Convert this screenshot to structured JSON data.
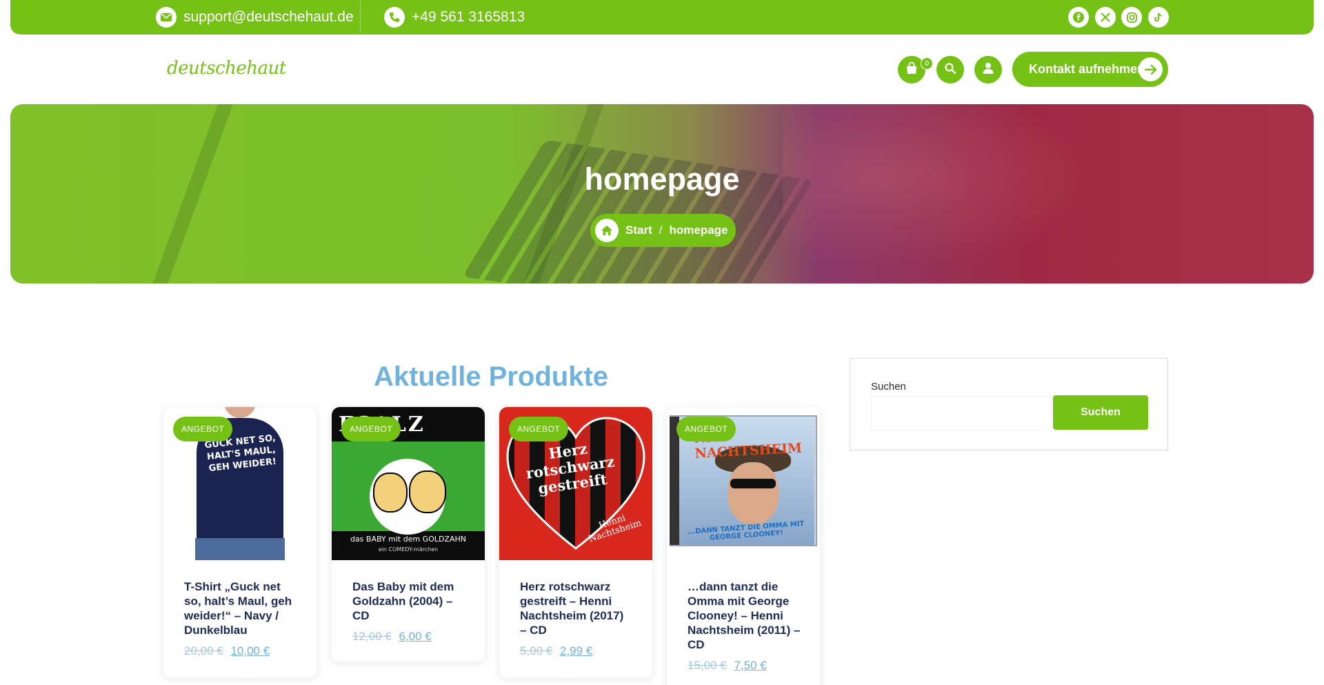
{
  "topbar": {
    "email": "support@deutschehaut.de",
    "phone": "+49 561 3165813",
    "social_icons": [
      "facebook-icon",
      "x-icon",
      "instagram-icon",
      "tiktok-icon"
    ]
  },
  "header": {
    "logo_text": "deutschehaut",
    "cart_count": "0",
    "contact_button": "Kontakt aufnehmen"
  },
  "hero": {
    "title": "homepage",
    "breadcrumb": {
      "home": "Start",
      "separator": "/",
      "current": "homepage"
    }
  },
  "products": {
    "section_title": "Aktuelle Produkte",
    "items": [
      {
        "badge": "ANGEBOT",
        "name": "T-Shirt „Guck net so, halt’s Maul, geh weider!“ – Navy / Dunkelblau",
        "old_price": "20,00 €",
        "new_price": "10,00 €",
        "image_text": "GUCK NET SO, HALT'S MAUL, GEH WEIDER!"
      },
      {
        "badge": "ANGEBOT",
        "name": "Das Baby mit dem Goldzahn (2004) – CD",
        "old_price": "12,00 €",
        "new_price": "6,00 €",
        "image_text_top": "ESALZ",
        "image_text_bottom": "das BABY mit dem GOLDZAHN",
        "image_text_sub": "ein COMEDY-märchen"
      },
      {
        "badge": "ANGEBOT",
        "name": "Herz rotschwarz gestreift – Henni Nachtsheim (2017) – CD",
        "old_price": "5,00 €",
        "new_price": "2,99 €",
        "image_text": "Herz rotschwarz gestreift",
        "image_sub": "Henni Nachtsheim"
      },
      {
        "badge": "ANGEBOT",
        "name": "…dann tanzt die Omma mit George Clooney! – Henni Nachtsheim (2011) – CD",
        "old_price": "15,00 €",
        "new_price": "7,50 €",
        "image_text": "NNI NACHTSHEIM",
        "image_sub": "...DANN TANZT DIE OMMA MIT GEORGE CLOONEY!"
      }
    ]
  },
  "sidebar": {
    "search_label": "Suchen",
    "search_value": "",
    "search_button": "Suchen"
  },
  "colors": {
    "brand_green": "#76c116",
    "link_blue": "#6fb3dc",
    "heading_navy": "#1d2b55"
  }
}
